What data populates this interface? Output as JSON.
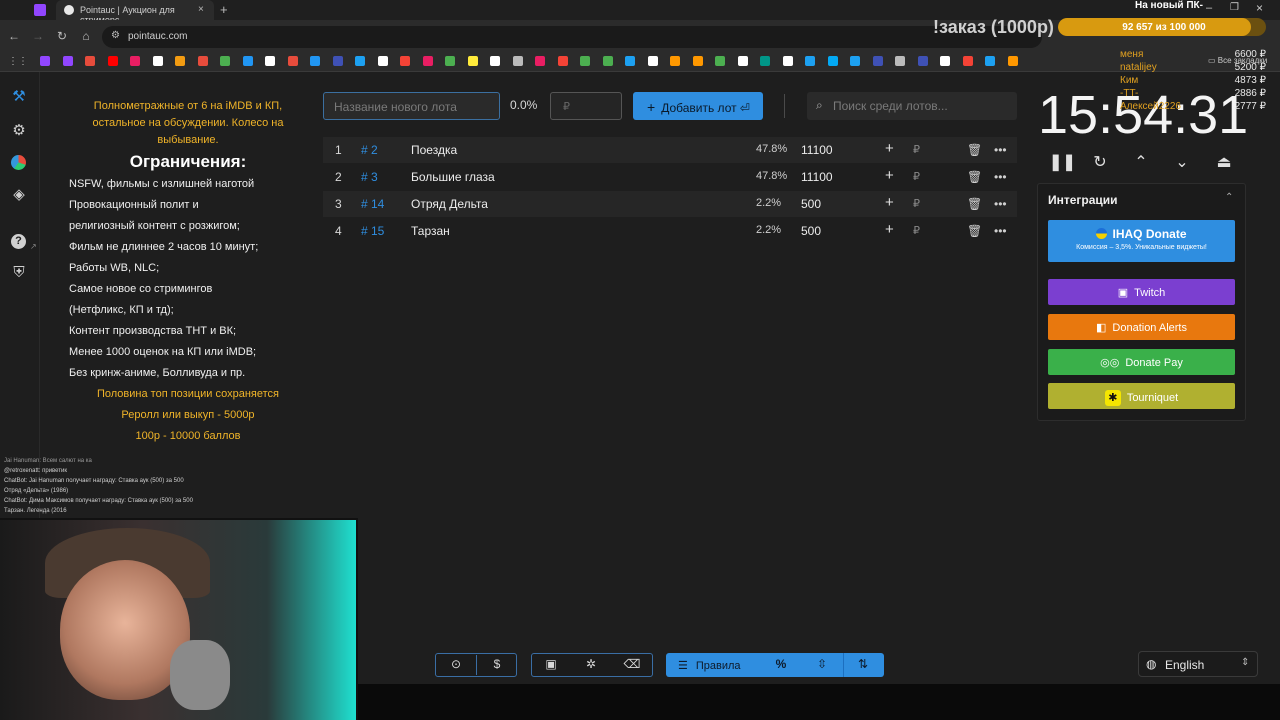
{
  "browser": {
    "tabs": [
      {
        "label": ""
      },
      {
        "label": "Pointauc | Аукцион для стримерс"
      }
    ],
    "url": "pointauc.com",
    "bookmarks_right": "Все закладки"
  },
  "sidebar": {
    "items": [
      "auction-icon",
      "gear-icon",
      "pie-chart-icon",
      "layers-icon",
      "help-icon",
      "shield-icon"
    ]
  },
  "rules": {
    "intro": "Полнометражные от 6 на iMDB и КП, остальное на обсуждении. Колесо на выбывание.",
    "heading": "Ограничения:",
    "lines": [
      "NSFW, фильмы с излишней наготой",
      "Провокационный полит и",
      "религиозный контент с розжигом;",
      "Фильм не длиннее 2 часов 10 минут;",
      "Работы WB, NLC;",
      "Самое новое со стримингов",
      "(Нетфликс, КП и тд);",
      "Контент производства ТНТ и ВК;",
      "Менее 1000 оценок на КП или iMDB;",
      "Без кринж-аниме, Болливуда и пр."
    ],
    "footer": [
      "Половина топ позиции сохраняется",
      "Реролл или выкуп - 5000р",
      "100р - 10000 баллов"
    ]
  },
  "controls": {
    "new_lot_placeholder": "Название нового лота",
    "percent": "0.0%",
    "amount_placeholder": "₽",
    "add_button": "Добавить лот ⏎",
    "search_placeholder": "Поиск среди лотов..."
  },
  "lots": [
    {
      "num": "1",
      "id": "# 2",
      "name": "Поездка",
      "pct": "47.8%",
      "amount": "11100"
    },
    {
      "num": "2",
      "id": "# 3",
      "name": "Большие глаза",
      "pct": "47.8%",
      "amount": "11100"
    },
    {
      "num": "3",
      "id": "# 14",
      "name": "Отряд Дельта",
      "pct": "2.2%",
      "amount": "500"
    },
    {
      "num": "4",
      "id": "# 15",
      "name": "Тарзан",
      "pct": "2.2%",
      "amount": "500"
    }
  ],
  "lot_actions": {
    "plus": "+",
    "rub": "₽"
  },
  "timer": {
    "value": "15:54:31"
  },
  "integrations": {
    "title": "Интеграции",
    "buttons": [
      {
        "label": "IHAQ Donate",
        "sub": "Комиссия – 3,5%. Уникальные виджеты!",
        "color": "#2f8ee0"
      },
      {
        "label": "Twitch",
        "color": "#7b3fd0"
      },
      {
        "label": "Donation Alerts",
        "color": "#e8780e"
      },
      {
        "label": "Donate Pay",
        "color": "#3ab04a"
      },
      {
        "label": "Tourniquet",
        "color": "#b0b030"
      }
    ]
  },
  "bottom_toolbar": {
    "rules_label": "Правила",
    "percent_icon": "%",
    "dollar": "$"
  },
  "language": {
    "value": "English"
  },
  "stream_overlay": {
    "title": "!заказ (1000р)",
    "goal_label": "На новый ПК-",
    "goal_text": "92 657 из 100 000",
    "goal_fraction": 0.9266,
    "donors": [
      {
        "name": "меня",
        "amount": "6600 ₽"
      },
      {
        "name": "natalijey",
        "amount": "5200 ₽"
      },
      {
        "name": "Ким",
        "amount": "4873 ₽"
      },
      {
        "name": "-TT-",
        "amount": "2886 ₽"
      },
      {
        "name": "Алексей2226",
        "amount": "2777 ₽"
      }
    ],
    "chat": [
      "Jai Hanuman: Всем салют на ка",
      "@retroxenatt: приветик",
      "ChatBot: Jai Hanuman получает награду: Ставка аук (500) за 500",
      "Отряд «Дельта» (1986)",
      "ChatBot: Дима Максимов получает награду: Ставка аук (500) за 500",
      "Тарзан. Легенда (2016"
    ]
  }
}
